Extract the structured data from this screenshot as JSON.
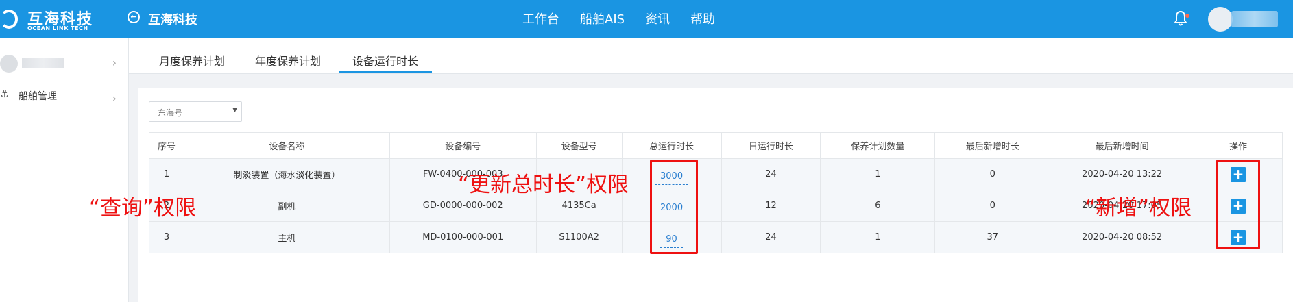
{
  "header": {
    "logo_cn": "互海科技",
    "logo_en": "OCEAN LINK TECH",
    "company": "互海科技",
    "nav": [
      "工作台",
      "船舶AIS",
      "资讯",
      "帮助"
    ]
  },
  "sidebar": {
    "items": [
      {
        "label": "船舶管理"
      }
    ]
  },
  "tabs": [
    {
      "label": "月度保养计划"
    },
    {
      "label": "年度保养计划"
    },
    {
      "label": "设备运行时长",
      "active": true
    }
  ],
  "filter": {
    "ship_select": "东海号"
  },
  "table": {
    "headers": [
      "序号",
      "设备名称",
      "设备编号",
      "设备型号",
      "总运行时长",
      "日运行时长",
      "保养计划数量",
      "最后新增时长",
      "最后新增时间",
      "操作"
    ],
    "rows": [
      {
        "no": "1",
        "name": "制淡装置（海水淡化装置）",
        "code": "FW-0400-000-003",
        "model": "",
        "total": "3000",
        "daily": "24",
        "plans": "1",
        "last_add": "0",
        "last_time": "2020-04-20 13:22"
      },
      {
        "no": "2",
        "name": "副机",
        "code": "GD-0000-000-002",
        "model": "4135Ca",
        "total": "2000",
        "daily": "12",
        "plans": "6",
        "last_add": "0",
        "last_time": "2020-04-20 17:05"
      },
      {
        "no": "3",
        "name": "主机",
        "code": "MD-0100-000-001",
        "model": "S1100A2",
        "total": "90",
        "daily": "24",
        "plans": "1",
        "last_add": "37",
        "last_time": "2020-04-20 08:52"
      }
    ]
  },
  "annotations": {
    "query": "“查询”权限",
    "update_total": "“更新总时长”权限",
    "add": "“新增”权限"
  },
  "colors": {
    "brand": "#1a95e2",
    "annotation": "#ee1111"
  }
}
